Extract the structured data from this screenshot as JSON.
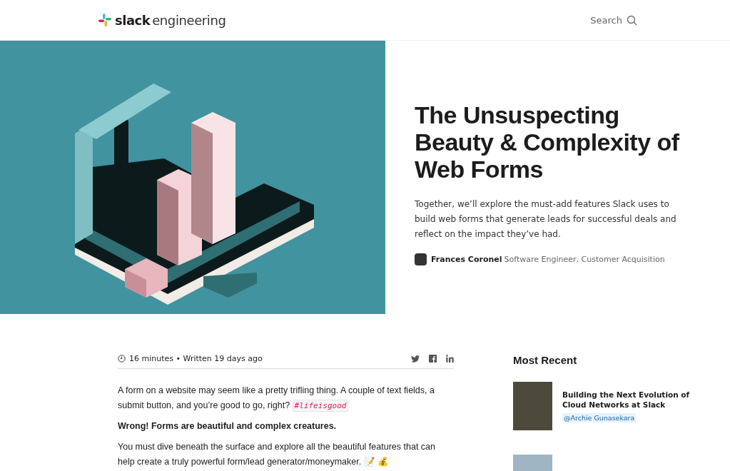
{
  "header": {
    "logo_bold": "slack",
    "logo_light": "engineering",
    "search": "Search"
  },
  "hero": {
    "title": "The Unsuspecting Beauty & Complexity of Web Forms",
    "summary": "Together, we’ll explore the must-add features Slack uses to build web forms that generate leads for successful deals and reflect on the impact they’ve had.",
    "author": "Frances Coronel",
    "author_role": "Software Engineer, Customer Acquisition"
  },
  "article": {
    "meta": "16 minutes • Written 19 days ago",
    "paragraphs": [
      {
        "kind": "code",
        "text": "A form on a website may seem like a pretty trifling thing. A couple of text fields, a submit button, and you’re good to go, right?",
        "code": "#lifeisgood"
      },
      {
        "kind": "bold",
        "text": "Wrong! Forms are beautiful and complex creatures."
      },
      {
        "kind": "plain",
        "text": "You must dive beneath the surface and explore all the beautiful features that can help create a truly powerful form/lead generator/moneymaker. 📝 💰"
      }
    ]
  },
  "sidebar": {
    "title": "Most Recent",
    "posts": [
      {
        "kind": "full",
        "title": "Building the Next Evolution of Cloud Networks at Slack",
        "author": "@Archie Gunasekara"
      },
      {
        "kind": "thumbnail_only"
      }
    ]
  }
}
